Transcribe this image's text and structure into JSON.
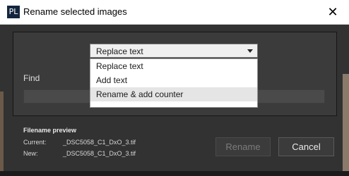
{
  "window": {
    "logo": "PL",
    "title": "Rename selected images",
    "close_glyph": "✕"
  },
  "form": {
    "mode_selected": "Replace text",
    "mode_options": [
      "Replace text",
      "Add text",
      "Rename & add counter"
    ],
    "find_label": "Find",
    "find_value": ""
  },
  "preview": {
    "title": "Filename preview",
    "current_label": "Current:",
    "current_value": "_DSC5058_C1_DxO_3.tif",
    "new_label": "New:",
    "new_value": "_DSC5058_C1_DxO_3.tif"
  },
  "buttons": {
    "rename": "Rename",
    "cancel": "Cancel"
  },
  "colors": {
    "logo_bg": "#14263f",
    "dialog_bg": "#323232",
    "panel_bg": "#3b3b3b"
  }
}
